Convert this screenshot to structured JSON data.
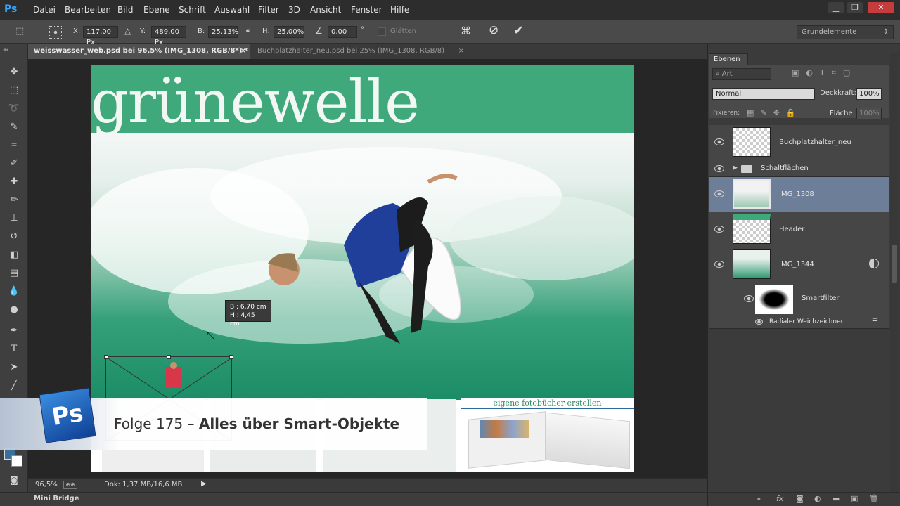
{
  "app": {
    "logo": "Ps"
  },
  "menu": [
    "Datei",
    "Bearbeiten",
    "Bild",
    "Ebene",
    "Schrift",
    "Auswahl",
    "Filter",
    "3D",
    "Ansicht",
    "Fenster",
    "Hilfe"
  ],
  "window_controls": [
    "minimize-icon",
    "restore-icon",
    "close-icon"
  ],
  "options": {
    "x_label": "X:",
    "x_value": "117,00 Px",
    "y_label": "Y:",
    "y_value": "489,00 Px",
    "w_label": "B:",
    "w_value": "25,13%",
    "h_label": "H:",
    "h_value": "25,00%",
    "angle_value": "0,00",
    "angle_unit": "°",
    "smooth_label": "Glätten",
    "workspace": "Grundelemente"
  },
  "tabs": [
    {
      "label": "weisswasser_web.psd bei 96,5% (IMG_1308, RGB/8*) *",
      "close": "×",
      "active": true
    },
    {
      "label": "Buchplatzhalter_neu.psd bei 25% (IMG_1308, RGB/8)",
      "close": "×",
      "active": false
    }
  ],
  "document": {
    "header_title": "grünewelle",
    "book_promo": "eigene fotobücher erstellen",
    "transform_tip": {
      "w": "B : 6,70 cm",
      "h": "H : 4,45 cm"
    }
  },
  "overlay": {
    "logo": "Ps",
    "episode": "Folge 175 – ",
    "title": "Alles über Smart-Objekte"
  },
  "status": {
    "zoom": "96,5%",
    "doc": "Dok: 1,37 MB/16,6 MB"
  },
  "mini_bridge": "Mini Bridge",
  "layers_panel": {
    "title": "Ebenen",
    "filter_kind": "Art",
    "blend_mode": "Normal",
    "opacity_label": "Deckkraft:",
    "opacity_value": "100%",
    "lock_label": "Fixieren:",
    "fill_label": "Fläche:",
    "fill_value": "100%",
    "layers": [
      {
        "name": "Buchplatzhalter_neu",
        "selected": false
      },
      {
        "name": "Schaltflächen",
        "selected": false,
        "group": true
      },
      {
        "name": "IMG_1308",
        "selected": true
      },
      {
        "name": "Header",
        "selected": false
      },
      {
        "name": "IMG_1344",
        "selected": false
      }
    ],
    "smartfilter_label": "Smartfilter",
    "filter_name": "Radialer Weichzeichner"
  },
  "colors": {
    "brand_green": "#3fa97b",
    "selection_blue": "#6d7f98",
    "ps_blue": "#31a8ff"
  }
}
